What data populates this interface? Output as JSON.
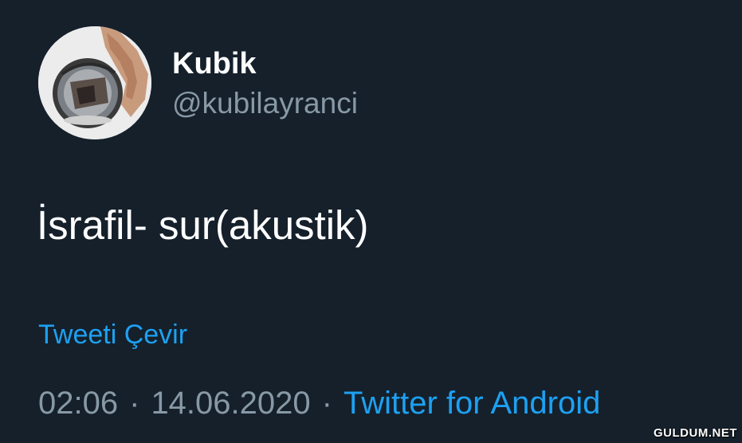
{
  "tweet": {
    "display_name": "Kubik",
    "handle": "@kubilayranci",
    "text": "İsrafil- sur(akustik)",
    "translate_label": "Tweeti Çevir",
    "time": "02:06",
    "separator": "·",
    "date": "14.06.2020",
    "source": "Twitter for Android"
  },
  "watermark": "GULDUM.NET",
  "colors": {
    "background": "#15202b",
    "primary_text": "#ffffff",
    "secondary_text": "#8899a6",
    "accent": "#1da1f2"
  }
}
